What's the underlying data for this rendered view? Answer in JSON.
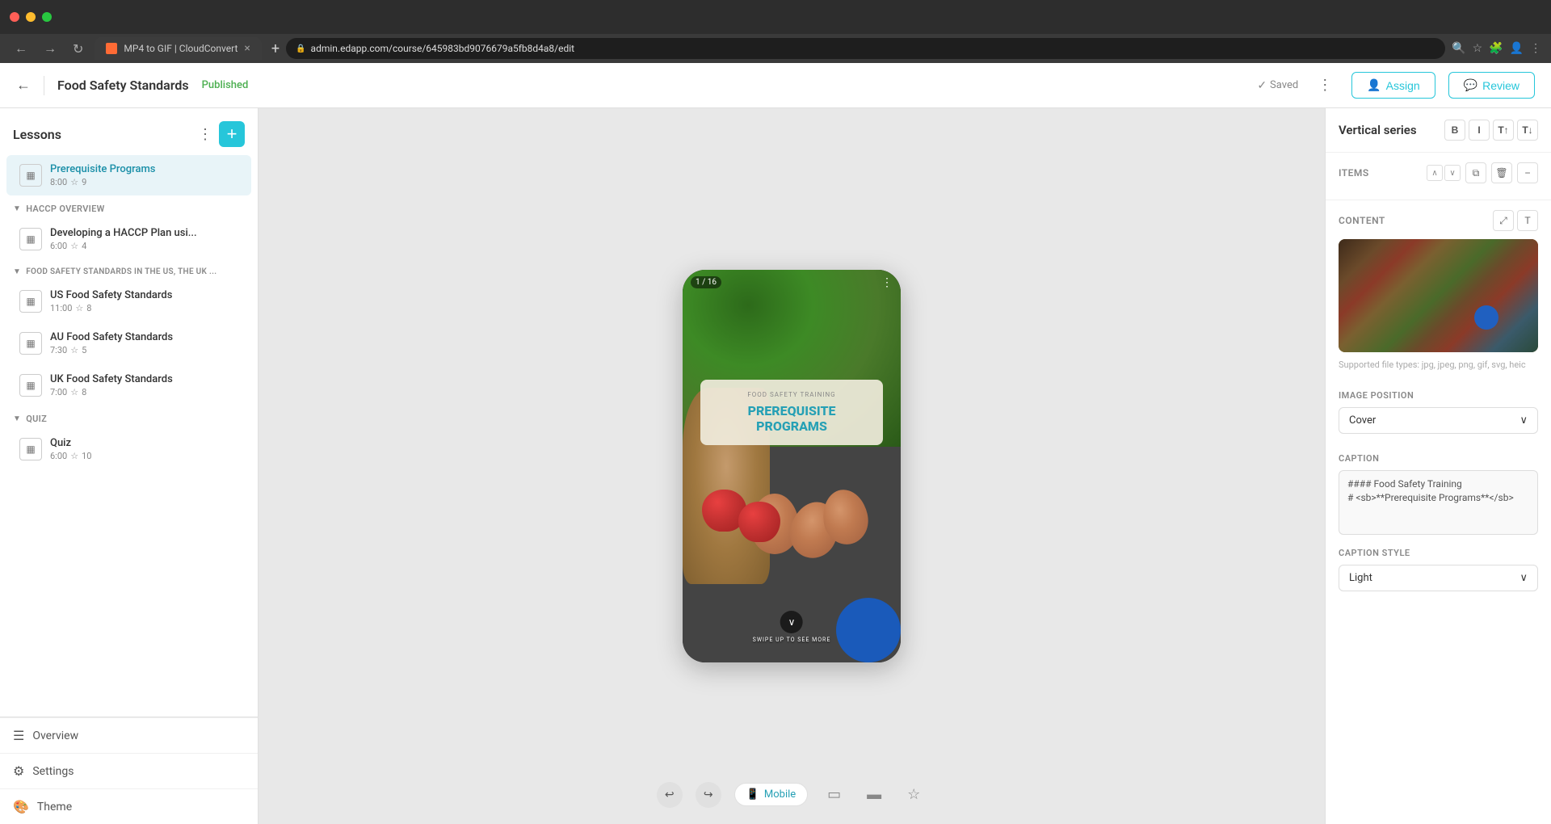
{
  "browser": {
    "tab_title": "MP4 to GIF | CloudConvert",
    "address": "admin.edapp.com/course/645983bd9076679a5fb8d4a8/edit",
    "new_tab_label": "+",
    "close_label": "×"
  },
  "header": {
    "back_label": "←",
    "course_title": "Food Safety Standards",
    "published_label": "Published",
    "saved_label": "Saved",
    "kebab_label": "⋮",
    "assign_label": "Assign",
    "review_label": "Review"
  },
  "sidebar": {
    "title": "Lessons",
    "add_label": "+",
    "lessons": [
      {
        "name": "Prerequisite Programs",
        "time": "8:00",
        "stars": "9",
        "active": true
      }
    ],
    "sections": [
      {
        "name": "HACCP Overview",
        "items": [
          {
            "name": "Developing a HACCP Plan usi...",
            "time": "6:00",
            "stars": "4"
          }
        ]
      },
      {
        "name": "FOOD SAFETY STANDARDS IN THE US, THE UK ...",
        "items": [
          {
            "name": "US Food Safety Standards",
            "time": "11:00",
            "stars": "8"
          },
          {
            "name": "AU Food Safety Standards",
            "time": "7:30",
            "stars": "5"
          },
          {
            "name": "UK Food Safety Standards",
            "time": "7:00",
            "stars": "8"
          }
        ]
      },
      {
        "name": "QUIZ",
        "items": [
          {
            "name": "Quiz",
            "time": "6:00",
            "stars": "10"
          }
        ]
      }
    ],
    "bottom_nav": [
      {
        "label": "Overview",
        "icon": "☰"
      },
      {
        "label": "Settings",
        "icon": "⚙"
      },
      {
        "label": "Theme",
        "icon": "🎨"
      }
    ]
  },
  "canvas": {
    "slide_counter": "1 / 16",
    "card_subtitle": "FOOD SAFETY TRAINING",
    "card_title_line1": "PREREQUISITE",
    "card_title_line2": "PROGRAMS",
    "swipe_text": "SWIPE UP TO SEE MORE",
    "nav_left": "‹",
    "nav_right": "›",
    "device_label": "Mobile",
    "device_icon": "📱"
  },
  "right_panel": {
    "title": "Vertical series",
    "format_btns": [
      "B",
      "I",
      "T↑",
      "T↓"
    ],
    "items_label": "Items",
    "collapse_label": "−",
    "content_label": "CONTENT",
    "supported_text": "Supported file types: jpg, jpeg, png, gif, svg, heic",
    "image_position_label": "IMAGE POSITION",
    "cover_label": "Cover",
    "caption_label": "CAPTION",
    "caption_value": "#### Food Safety Training\n# <sb>**Prerequisite Programs**</sb>",
    "caption_style_label": "CAPTION STYLE",
    "light_label": "Light",
    "chevron": "∨"
  }
}
